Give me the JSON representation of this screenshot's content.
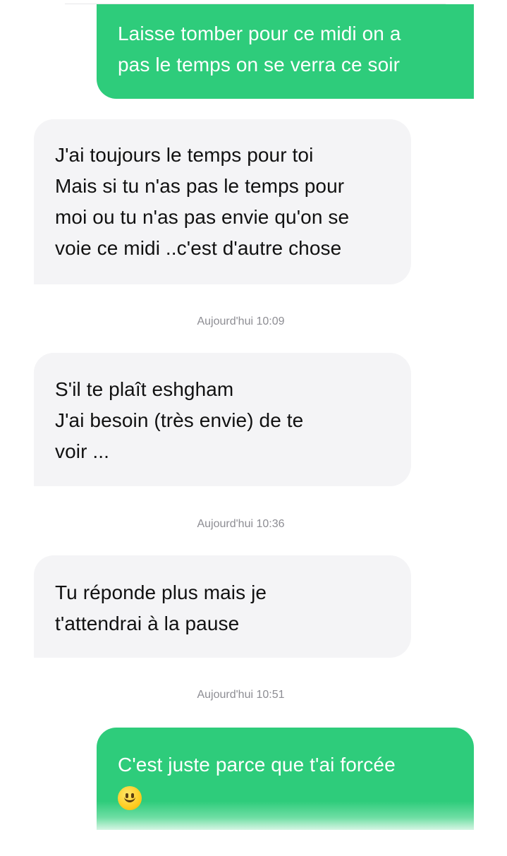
{
  "conversation": {
    "messages": [
      {
        "direction": "sent",
        "lines": [
          "Laisse tomber pour ce midi on a",
          "pas le temps on se verra ce soir"
        ]
      },
      {
        "direction": "received",
        "lines": [
          "J'ai toujours le temps pour toi",
          "Mais si tu n'as pas le temps pour",
          "moi ou tu n'as pas envie qu'on se",
          "voie ce midi ..c'est d'autre chose"
        ]
      },
      {
        "direction": "received",
        "timestamp": "Aujourd'hui 10:09",
        "lines": [
          "S'il te plaît eshgham",
          "J'ai besoin (très envie) de te",
          "voir ..."
        ]
      },
      {
        "direction": "received",
        "timestamp": "Aujourd'hui 10:36",
        "lines": [
          "Tu réponde plus mais je",
          "t'attendrai à la pause"
        ]
      },
      {
        "direction": "sent",
        "timestamp": "Aujourd'hui 10:51",
        "lines": [
          "C'est juste parce que t'ai forcée"
        ],
        "emoji": "slightly-smiling-face-icon"
      }
    ]
  },
  "colors": {
    "sent_bubble": "#2ecc7b",
    "received_bubble": "#f4f4f6",
    "timestamp_text": "#8d8d93"
  }
}
